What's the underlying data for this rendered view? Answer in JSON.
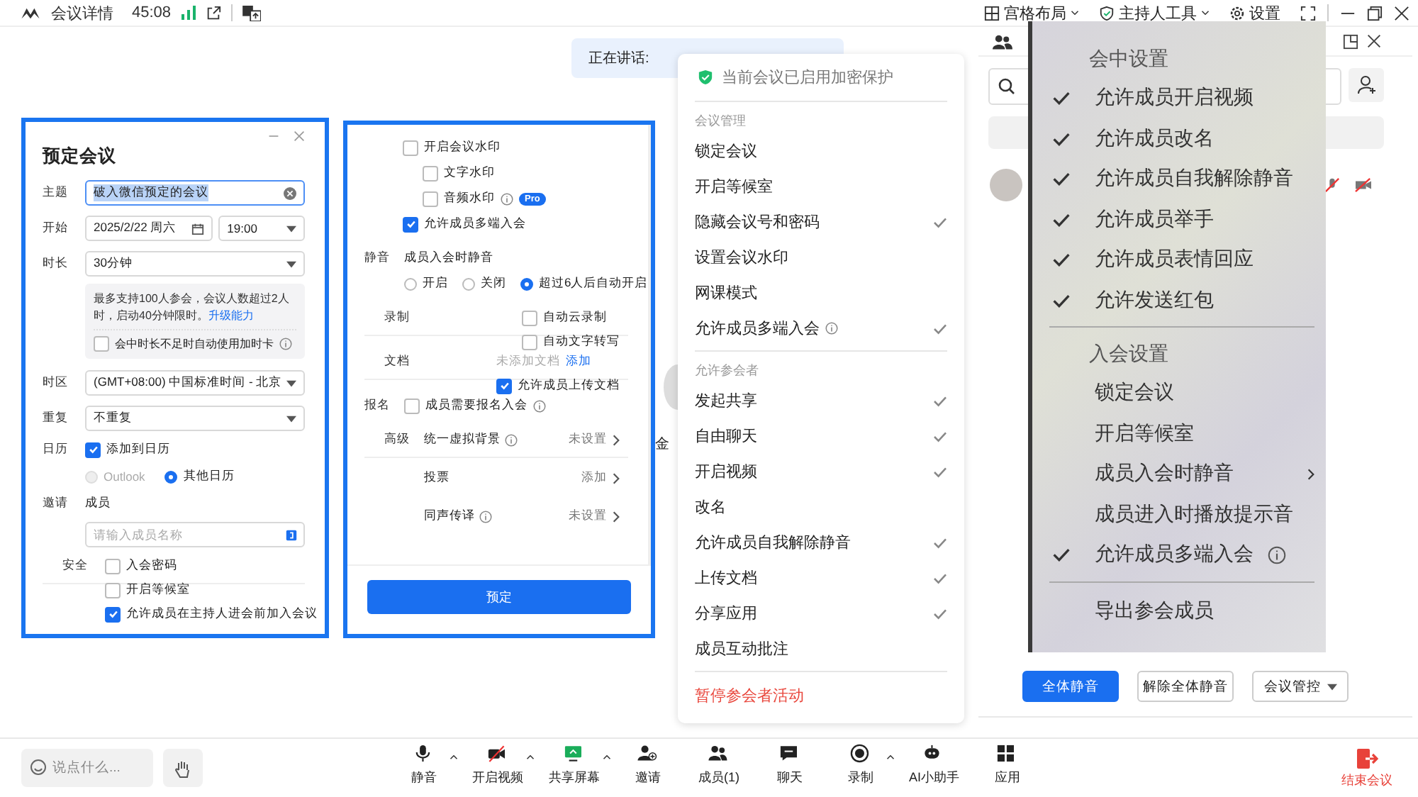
{
  "top_bar": {
    "title": "会议详情",
    "timer": "45:08",
    "tools": [
      {
        "label": "宫格布局",
        "kind": "grid"
      },
      {
        "label": "主持人工具",
        "kind": "shield"
      },
      {
        "label": "设置",
        "kind": "gear"
      }
    ]
  },
  "speaking": {
    "label": "正在讲话:"
  },
  "stage": {
    "name_fragment": "金"
  },
  "schedule_dialog": {
    "title": "预定会议",
    "topic": {
      "label": "主题",
      "value": "破入微信预定的会议"
    },
    "start": {
      "label": "开始",
      "date": "2025/2/22 周六",
      "time": "19:00"
    },
    "duration": {
      "label": "时长",
      "value": "30分钟"
    },
    "notice": {
      "text": "最多支持100人参会，会议人数超过2人时，启动40分钟限时。",
      "link": "升级能力",
      "option": {
        "label": "会中时长不足时自动使用加时卡",
        "checked": false
      }
    },
    "timezone": {
      "label": "时区",
      "value": "(GMT+08:00) 中国标准时间 - 北京"
    },
    "repeat": {
      "label": "重复",
      "value": "不重复"
    },
    "calendar": {
      "label": "日历",
      "add": {
        "label": "添加到日历",
        "checked": true
      },
      "options": [
        {
          "label": "Outlook",
          "selected": false,
          "disabled": true
        },
        {
          "label": "其他日历",
          "selected": true,
          "disabled": false
        }
      ]
    },
    "invite": {
      "label": "邀请",
      "sublabel": "成员",
      "placeholder": "请输入成员名称"
    },
    "security": {
      "label": "安全",
      "options": [
        {
          "label": "入会密码",
          "checked": false
        },
        {
          "label": "开启等候室",
          "checked": false
        },
        {
          "label": "允许成员在主持人进会前加入会议",
          "checked": true
        }
      ]
    }
  },
  "settings_dialog": {
    "watermark": {
      "label": "开启会议水印",
      "checked": false,
      "children": [
        {
          "label": "文字水印",
          "checked": false,
          "info": false
        },
        {
          "label": "音频水印",
          "checked": false,
          "info": true,
          "badge": "Pro"
        }
      ]
    },
    "multi_device": {
      "label": "允许成员多端入会",
      "checked": true
    },
    "mute": {
      "label": "静音",
      "sublabel": "成员入会时静音",
      "options": [
        {
          "label": "开启",
          "selected": false
        },
        {
          "label": "关闭",
          "selected": false
        },
        {
          "label": "超过6人后自动开启",
          "selected": true
        }
      ]
    },
    "record": {
      "label": "录制",
      "options": [
        {
          "label": "自动云录制",
          "checked": false
        },
        {
          "label": "自动文字转写",
          "checked": false
        }
      ]
    },
    "docs": {
      "label": "文档",
      "status": "未添加文档",
      "link": "添加",
      "upload": {
        "label": "允许成员上传文档",
        "checked": true
      }
    },
    "signup": {
      "label": "报名",
      "option": {
        "label": "成员需要报名入会",
        "checked": false
      }
    },
    "advanced": {
      "label": "高级",
      "rows": [
        {
          "label": "统一虚拟背景",
          "info": true,
          "value": "未设置"
        },
        {
          "label": "投票",
          "info": false,
          "value": "添加"
        },
        {
          "label": "同声传译",
          "info": true,
          "value": "未设置"
        }
      ]
    },
    "submit": "预定"
  },
  "control_menu": {
    "header": "当前会议已启用加密保护",
    "sections": [
      {
        "title": "会议管理",
        "items": [
          {
            "label": "锁定会议",
            "checked": false,
            "info": false
          },
          {
            "label": "开启等候室",
            "checked": false,
            "info": false
          },
          {
            "label": "隐藏会议号和密码",
            "checked": true,
            "info": false
          },
          {
            "label": "设置会议水印",
            "checked": false,
            "info": false
          },
          {
            "label": "网课模式",
            "checked": false,
            "info": false
          },
          {
            "label": "允许成员多端入会",
            "checked": true,
            "info": true
          }
        ]
      },
      {
        "title": "允许参会者",
        "items": [
          {
            "label": "发起共享",
            "checked": true,
            "info": false
          },
          {
            "label": "自由聊天",
            "checked": true,
            "info": false
          },
          {
            "label": "开启视频",
            "checked": true,
            "info": false
          },
          {
            "label": "改名",
            "checked": false,
            "info": false
          },
          {
            "label": "允许成员自我解除静音",
            "checked": true,
            "info": false
          },
          {
            "label": "上传文档",
            "checked": true,
            "info": false
          },
          {
            "label": "分享应用",
            "checked": true,
            "info": false
          },
          {
            "label": "成员互动批注",
            "checked": false,
            "info": false
          }
        ]
      }
    ],
    "danger": "暂停参会者活动"
  },
  "members_panel": {
    "buttons": [
      {
        "label": "全体静音",
        "primary": true,
        "dropdown": false
      },
      {
        "label": "解除全体静音",
        "primary": false,
        "dropdown": false
      },
      {
        "label": "会议管控",
        "primary": false,
        "dropdown": true
      }
    ]
  },
  "overlay_menu": {
    "sections": [
      {
        "title": "会中设置",
        "items": [
          {
            "label": "允许成员开启视频",
            "checked": true,
            "submenu": false,
            "info": false
          },
          {
            "label": "允许成员改名",
            "checked": true,
            "submenu": false,
            "info": false
          },
          {
            "label": "允许成员自我解除静音",
            "checked": true,
            "submenu": false,
            "info": false
          },
          {
            "label": "允许成员举手",
            "checked": true,
            "submenu": false,
            "info": false
          },
          {
            "label": "允许成员表情回应",
            "checked": true,
            "submenu": false,
            "info": false
          },
          {
            "label": "允许发送红包",
            "checked": true,
            "submenu": false,
            "info": false
          }
        ]
      },
      {
        "title": "入会设置",
        "items": [
          {
            "label": "锁定会议",
            "checked": false,
            "submenu": false,
            "info": false
          },
          {
            "label": "开启等候室",
            "checked": false,
            "submenu": false,
            "info": false
          },
          {
            "label": "成员入会时静音",
            "checked": false,
            "submenu": true,
            "info": false
          },
          {
            "label": "成员进入时播放提示音",
            "checked": false,
            "submenu": false,
            "info": false
          },
          {
            "label": "允许成员多端入会",
            "checked": true,
            "submenu": false,
            "info": true
          }
        ]
      },
      {
        "items": [
          {
            "label": "导出参会成员",
            "checked": false,
            "submenu": false,
            "info": false
          }
        ]
      }
    ]
  },
  "bottom_bar": {
    "chat_placeholder": "说点什么...",
    "tools": [
      {
        "label": "静音",
        "kind": "mic",
        "caret": true
      },
      {
        "label": "开启视频",
        "kind": "video-off",
        "caret": true
      },
      {
        "label": "共享屏幕",
        "kind": "screen",
        "caret": true
      },
      {
        "label": "邀请",
        "kind": "add-user",
        "caret": false
      },
      {
        "label": "成员(1)",
        "kind": "users",
        "caret": false
      },
      {
        "label": "聊天",
        "kind": "chat",
        "caret": false
      },
      {
        "label": "录制",
        "kind": "record",
        "caret": true
      },
      {
        "label": "AI小助手",
        "kind": "robot",
        "caret": false
      },
      {
        "label": "应用",
        "kind": "apps",
        "caret": false
      }
    ],
    "end": "结束会议"
  }
}
